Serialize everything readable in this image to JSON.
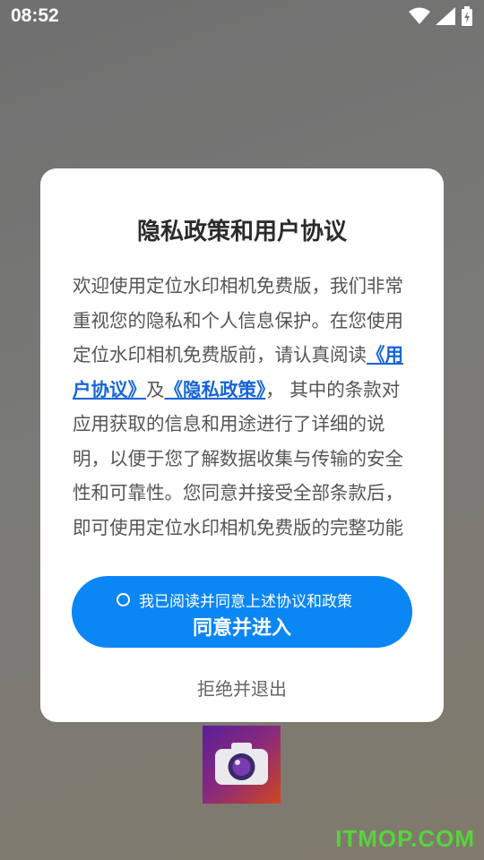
{
  "status_bar": {
    "time": "08:52",
    "icons": [
      "wifi-icon",
      "signal-icon",
      "battery-charging-icon"
    ]
  },
  "dialog": {
    "title": "隐私政策和用户协议",
    "body_part1": "欢迎使用定位水印相机免费版，我们非常重视您的隐私和个人信息保护。在您使用定位水印相机免费版前，请认真阅读",
    "user_agreement_link": "《用户协议》",
    "body_and": "及",
    "privacy_policy_link": "《隐私政策》",
    "body_part2": "， 其中的条款对应用获取的信息和用途进行了详细的说明，以便于您了解数据收集与传输的安全性和可靠性。您同意并接受全部条款后，即可使用定位水印相机免费版的完整功能",
    "consent_checkbox_label": "我已阅读并同意上述协议和政策",
    "agree_button": "同意并进入",
    "reject_button": "拒绝并退出"
  },
  "background": {
    "app_icon": "camera-icon"
  },
  "watermark": "ITMOP.COM",
  "colors": {
    "accent": "#0a86f5",
    "link": "#1565d8"
  }
}
